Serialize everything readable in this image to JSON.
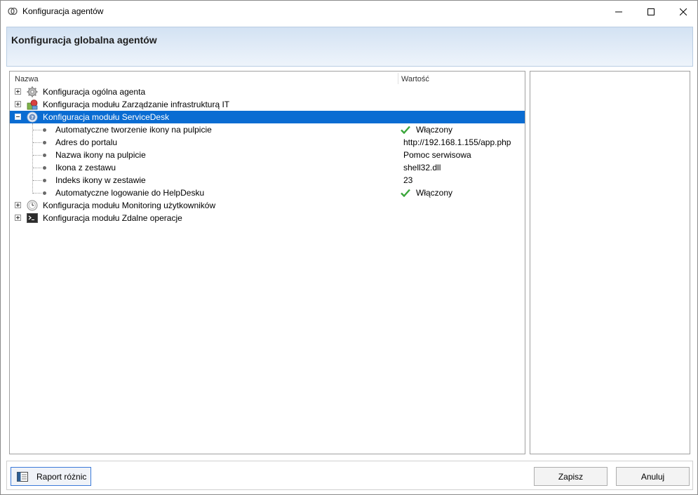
{
  "window": {
    "title": "Konfiguracja agentów"
  },
  "header": {
    "title": "Konfiguracja globalna agentów"
  },
  "tree": {
    "columns": {
      "name": "Nazwa",
      "value": "Wartość"
    },
    "nodes": [
      {
        "label": "Konfiguracja ogólna agenta",
        "icon": "gear-icon",
        "expanded": false
      },
      {
        "label": "Konfiguracja modułu Zarządzanie infrastrukturą IT",
        "icon": "infrastructure-icon",
        "expanded": false
      },
      {
        "label": "Konfiguracja modułu ServiceDesk",
        "icon": "servicedesk-icon",
        "expanded": true,
        "selected": true
      },
      {
        "label": "Konfiguracja modułu Monitoring użytkowników",
        "icon": "monitoring-icon",
        "expanded": false
      },
      {
        "label": "Konfiguracja modułu Zdalne operacje",
        "icon": "terminal-icon",
        "expanded": false
      }
    ],
    "children": [
      {
        "label": "Automatyczne tworzenie ikony na pulpicie",
        "value": "Włączony",
        "check": true
      },
      {
        "label": "Adres do portalu",
        "value": "http://192.168.1.155/app.php",
        "check": false
      },
      {
        "label": "Nazwa ikony na pulpicie",
        "value": "Pomoc serwisowa",
        "check": false
      },
      {
        "label": "Ikona z zestawu",
        "value": "shell32.dll",
        "check": false
      },
      {
        "label": "Indeks ikony w zestawie",
        "value": "23",
        "check": false
      },
      {
        "label": "Automatyczne logowanie do HelpDesku",
        "value": "Włączony",
        "check": true
      }
    ]
  },
  "buttons": {
    "report": "Raport różnic",
    "save": "Zapisz",
    "cancel": "Anuluj"
  },
  "colors": {
    "selection": "#0a6cd2",
    "check": "#3aa63a",
    "header_band": "#d3e2f3"
  }
}
